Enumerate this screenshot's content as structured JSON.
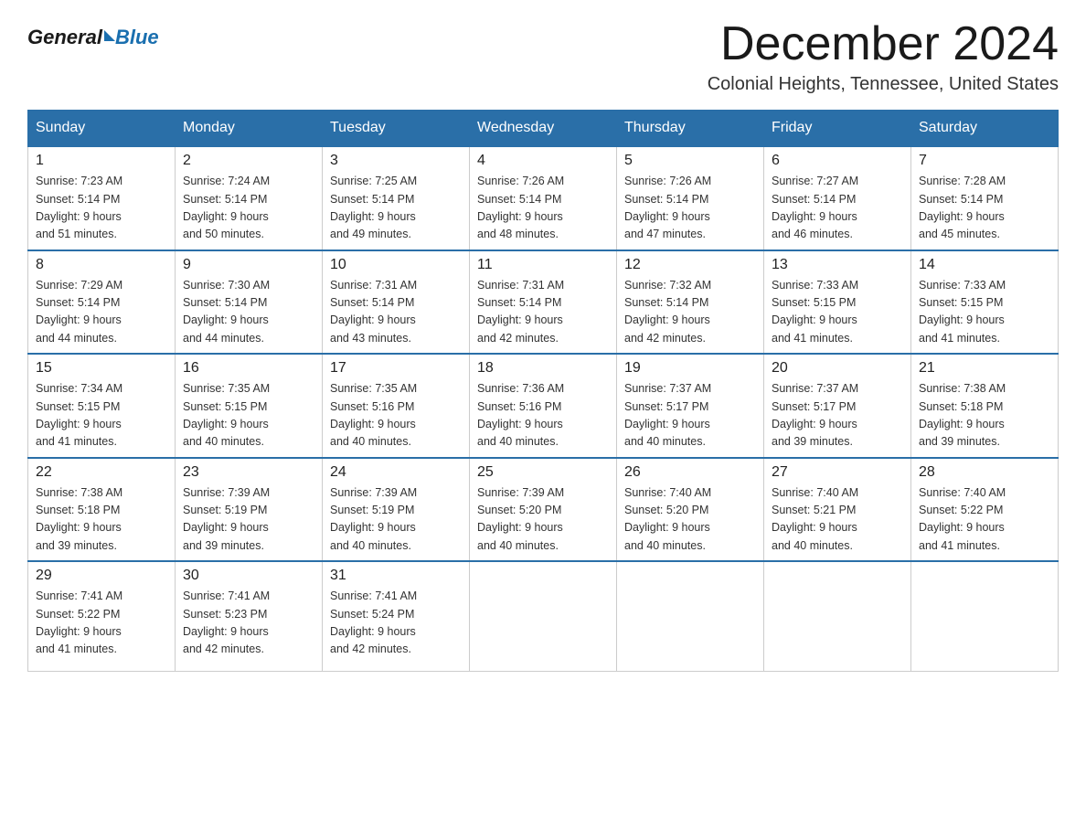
{
  "logo": {
    "general": "General",
    "blue": "Blue"
  },
  "header": {
    "month": "December 2024",
    "location": "Colonial Heights, Tennessee, United States"
  },
  "weekdays": [
    "Sunday",
    "Monday",
    "Tuesday",
    "Wednesday",
    "Thursday",
    "Friday",
    "Saturday"
  ],
  "weeks": [
    [
      {
        "day": "1",
        "sunrise": "7:23 AM",
        "sunset": "5:14 PM",
        "daylight": "9 hours and 51 minutes."
      },
      {
        "day": "2",
        "sunrise": "7:24 AM",
        "sunset": "5:14 PM",
        "daylight": "9 hours and 50 minutes."
      },
      {
        "day": "3",
        "sunrise": "7:25 AM",
        "sunset": "5:14 PM",
        "daylight": "9 hours and 49 minutes."
      },
      {
        "day": "4",
        "sunrise": "7:26 AM",
        "sunset": "5:14 PM",
        "daylight": "9 hours and 48 minutes."
      },
      {
        "day": "5",
        "sunrise": "7:26 AM",
        "sunset": "5:14 PM",
        "daylight": "9 hours and 47 minutes."
      },
      {
        "day": "6",
        "sunrise": "7:27 AM",
        "sunset": "5:14 PM",
        "daylight": "9 hours and 46 minutes."
      },
      {
        "day": "7",
        "sunrise": "7:28 AM",
        "sunset": "5:14 PM",
        "daylight": "9 hours and 45 minutes."
      }
    ],
    [
      {
        "day": "8",
        "sunrise": "7:29 AM",
        "sunset": "5:14 PM",
        "daylight": "9 hours and 44 minutes."
      },
      {
        "day": "9",
        "sunrise": "7:30 AM",
        "sunset": "5:14 PM",
        "daylight": "9 hours and 44 minutes."
      },
      {
        "day": "10",
        "sunrise": "7:31 AM",
        "sunset": "5:14 PM",
        "daylight": "9 hours and 43 minutes."
      },
      {
        "day": "11",
        "sunrise": "7:31 AM",
        "sunset": "5:14 PM",
        "daylight": "9 hours and 42 minutes."
      },
      {
        "day": "12",
        "sunrise": "7:32 AM",
        "sunset": "5:14 PM",
        "daylight": "9 hours and 42 minutes."
      },
      {
        "day": "13",
        "sunrise": "7:33 AM",
        "sunset": "5:15 PM",
        "daylight": "9 hours and 41 minutes."
      },
      {
        "day": "14",
        "sunrise": "7:33 AM",
        "sunset": "5:15 PM",
        "daylight": "9 hours and 41 minutes."
      }
    ],
    [
      {
        "day": "15",
        "sunrise": "7:34 AM",
        "sunset": "5:15 PM",
        "daylight": "9 hours and 41 minutes."
      },
      {
        "day": "16",
        "sunrise": "7:35 AM",
        "sunset": "5:15 PM",
        "daylight": "9 hours and 40 minutes."
      },
      {
        "day": "17",
        "sunrise": "7:35 AM",
        "sunset": "5:16 PM",
        "daylight": "9 hours and 40 minutes."
      },
      {
        "day": "18",
        "sunrise": "7:36 AM",
        "sunset": "5:16 PM",
        "daylight": "9 hours and 40 minutes."
      },
      {
        "day": "19",
        "sunrise": "7:37 AM",
        "sunset": "5:17 PM",
        "daylight": "9 hours and 40 minutes."
      },
      {
        "day": "20",
        "sunrise": "7:37 AM",
        "sunset": "5:17 PM",
        "daylight": "9 hours and 39 minutes."
      },
      {
        "day": "21",
        "sunrise": "7:38 AM",
        "sunset": "5:18 PM",
        "daylight": "9 hours and 39 minutes."
      }
    ],
    [
      {
        "day": "22",
        "sunrise": "7:38 AM",
        "sunset": "5:18 PM",
        "daylight": "9 hours and 39 minutes."
      },
      {
        "day": "23",
        "sunrise": "7:39 AM",
        "sunset": "5:19 PM",
        "daylight": "9 hours and 39 minutes."
      },
      {
        "day": "24",
        "sunrise": "7:39 AM",
        "sunset": "5:19 PM",
        "daylight": "9 hours and 40 minutes."
      },
      {
        "day": "25",
        "sunrise": "7:39 AM",
        "sunset": "5:20 PM",
        "daylight": "9 hours and 40 minutes."
      },
      {
        "day": "26",
        "sunrise": "7:40 AM",
        "sunset": "5:20 PM",
        "daylight": "9 hours and 40 minutes."
      },
      {
        "day": "27",
        "sunrise": "7:40 AM",
        "sunset": "5:21 PM",
        "daylight": "9 hours and 40 minutes."
      },
      {
        "day": "28",
        "sunrise": "7:40 AM",
        "sunset": "5:22 PM",
        "daylight": "9 hours and 41 minutes."
      }
    ],
    [
      {
        "day": "29",
        "sunrise": "7:41 AM",
        "sunset": "5:22 PM",
        "daylight": "9 hours and 41 minutes."
      },
      {
        "day": "30",
        "sunrise": "7:41 AM",
        "sunset": "5:23 PM",
        "daylight": "9 hours and 42 minutes."
      },
      {
        "day": "31",
        "sunrise": "7:41 AM",
        "sunset": "5:24 PM",
        "daylight": "9 hours and 42 minutes."
      },
      null,
      null,
      null,
      null
    ]
  ],
  "labels": {
    "sunrise": "Sunrise:",
    "sunset": "Sunset:",
    "daylight": "Daylight:"
  }
}
